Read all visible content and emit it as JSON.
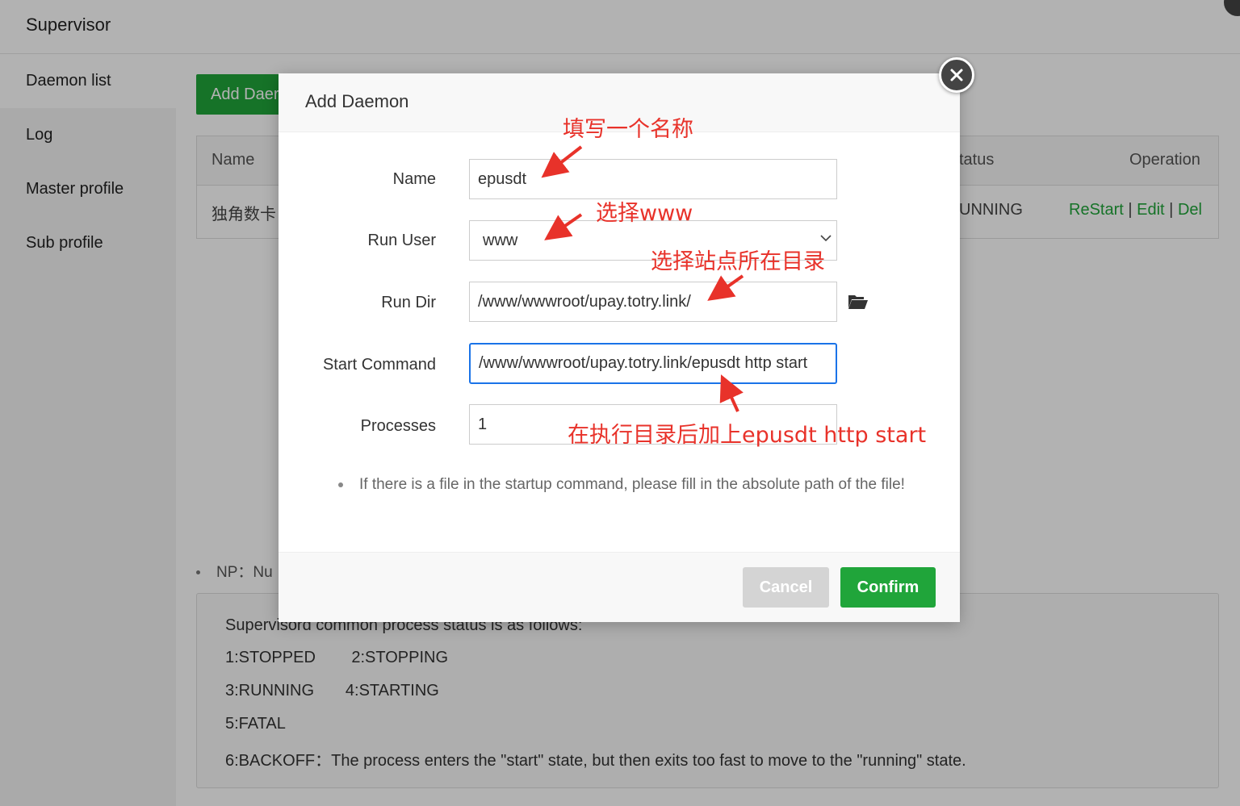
{
  "app": {
    "title": "Supervisor"
  },
  "sidebar": {
    "items": [
      {
        "label": "Daemon list"
      },
      {
        "label": "Log"
      },
      {
        "label": "Master profile"
      },
      {
        "label": "Sub profile"
      }
    ]
  },
  "toolbar": {
    "add_label": "Add Daer"
  },
  "table": {
    "headers": {
      "name": "Name",
      "status": "tatus",
      "operation": "Operation"
    },
    "rows": [
      {
        "name": "独角数卡",
        "status": "UNNING",
        "restart": "ReStart",
        "edit": "Edit",
        "del": "Del",
        "sep": "|"
      }
    ]
  },
  "notes": {
    "np": "NP：Nu",
    "status_lines": [
      "Supervisord common process status is as follows:",
      "1:STOPPED        2:STOPPING",
      "3:RUNNING       4:STARTING",
      "5:FATAL",
      "6:BACKOFF：The process enters the \"start\" state, but then exits too fast to move to the \"running\" state."
    ]
  },
  "modal": {
    "title": "Add Daemon",
    "fields": {
      "name": {
        "label": "Name",
        "value": "epusdt"
      },
      "run_user": {
        "label": "Run User",
        "value": "www"
      },
      "run_dir": {
        "label": "Run Dir",
        "value": "/www/wwwroot/upay.totry.link/"
      },
      "start_command": {
        "label": "Start Command",
        "value": "/www/wwwroot/upay.totry.link/epusdt http start"
      },
      "processes": {
        "label": "Processes",
        "value": "1"
      }
    },
    "hint": "If there is a file in the startup command, please fill in the absolute path of the file!",
    "cancel_label": "Cancel",
    "confirm_label": "Confirm"
  },
  "annotations": {
    "name": "填写一个名称",
    "run_user": "选择www",
    "run_dir": "选择站点所在目录",
    "start_command": "在执行目录后加上epusdt http start",
    "color": "#e8322a"
  },
  "colors": {
    "accent": "#20a53a",
    "focus": "#1a73e8"
  },
  "icons": {
    "close": "close-icon",
    "folder": "folder-open-icon",
    "chevron": "chevron-down-icon"
  }
}
